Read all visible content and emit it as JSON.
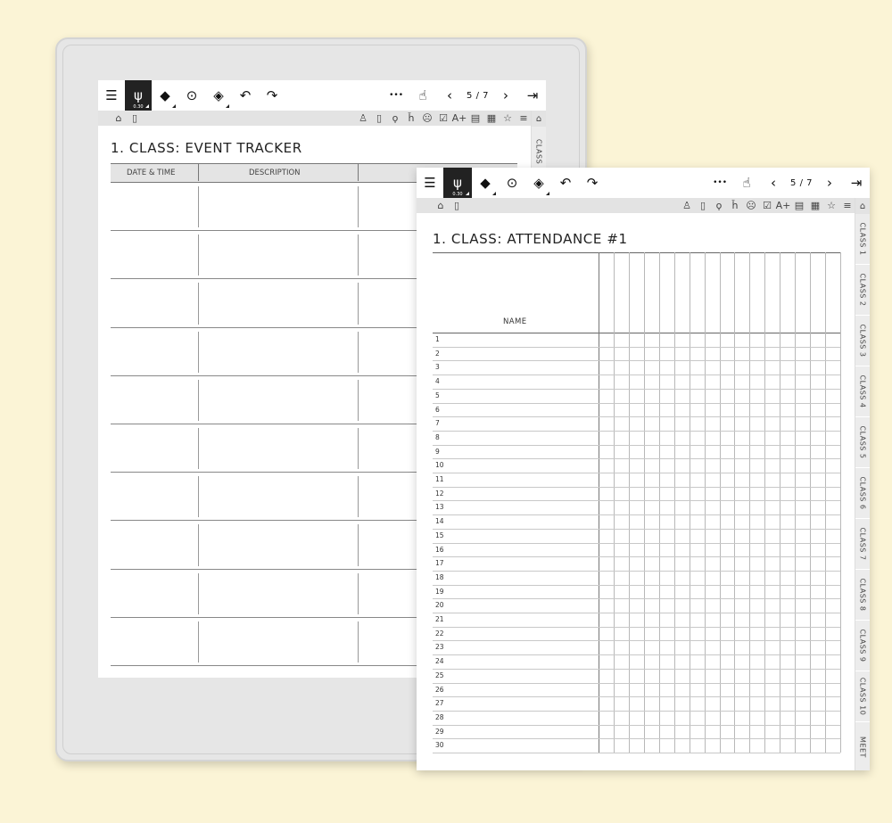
{
  "toolbar": {
    "pen_width_label": "0.30",
    "more_label": "•••",
    "page_indicator": "5 / 7"
  },
  "back_page": {
    "title": "1. CLASS: EVENT TRACKER",
    "columns": [
      "DATE & TIME",
      "DESCRIPTION"
    ],
    "side_tab": "CLASS",
    "row_count": 10
  },
  "front_page": {
    "title": "1. CLASS: ATTENDANCE #1",
    "name_header": "NAME",
    "rows": [
      "1",
      "2",
      "3",
      "4",
      "5",
      "6",
      "7",
      "8",
      "9",
      "10",
      "11",
      "12",
      "13",
      "14",
      "15",
      "16",
      "17",
      "18",
      "19",
      "20",
      "21",
      "22",
      "23",
      "24",
      "25",
      "26",
      "27",
      "28",
      "29",
      "30"
    ],
    "attendance_columns": 16,
    "tabs": [
      "CLASS 1",
      "CLASS 2",
      "CLASS 3",
      "CLASS 4",
      "CLASS 5",
      "CLASS 6",
      "CLASS 7",
      "CLASS 8",
      "CLASS 9",
      "CLASS 10",
      "MEET"
    ]
  },
  "icons": {
    "toolbar": [
      "toc-icon",
      "pen-icon",
      "eraser-icon",
      "lasso-icon",
      "layers-icon",
      "undo-icon",
      "redo-icon"
    ],
    "iconbar": [
      "user-icon",
      "page-icon",
      "bulb-icon",
      "chair-icon",
      "smiley-icon",
      "checkbox-icon",
      "grade-icon",
      "book-icon",
      "calendar-icon",
      "star-icon",
      "list-icon"
    ]
  }
}
